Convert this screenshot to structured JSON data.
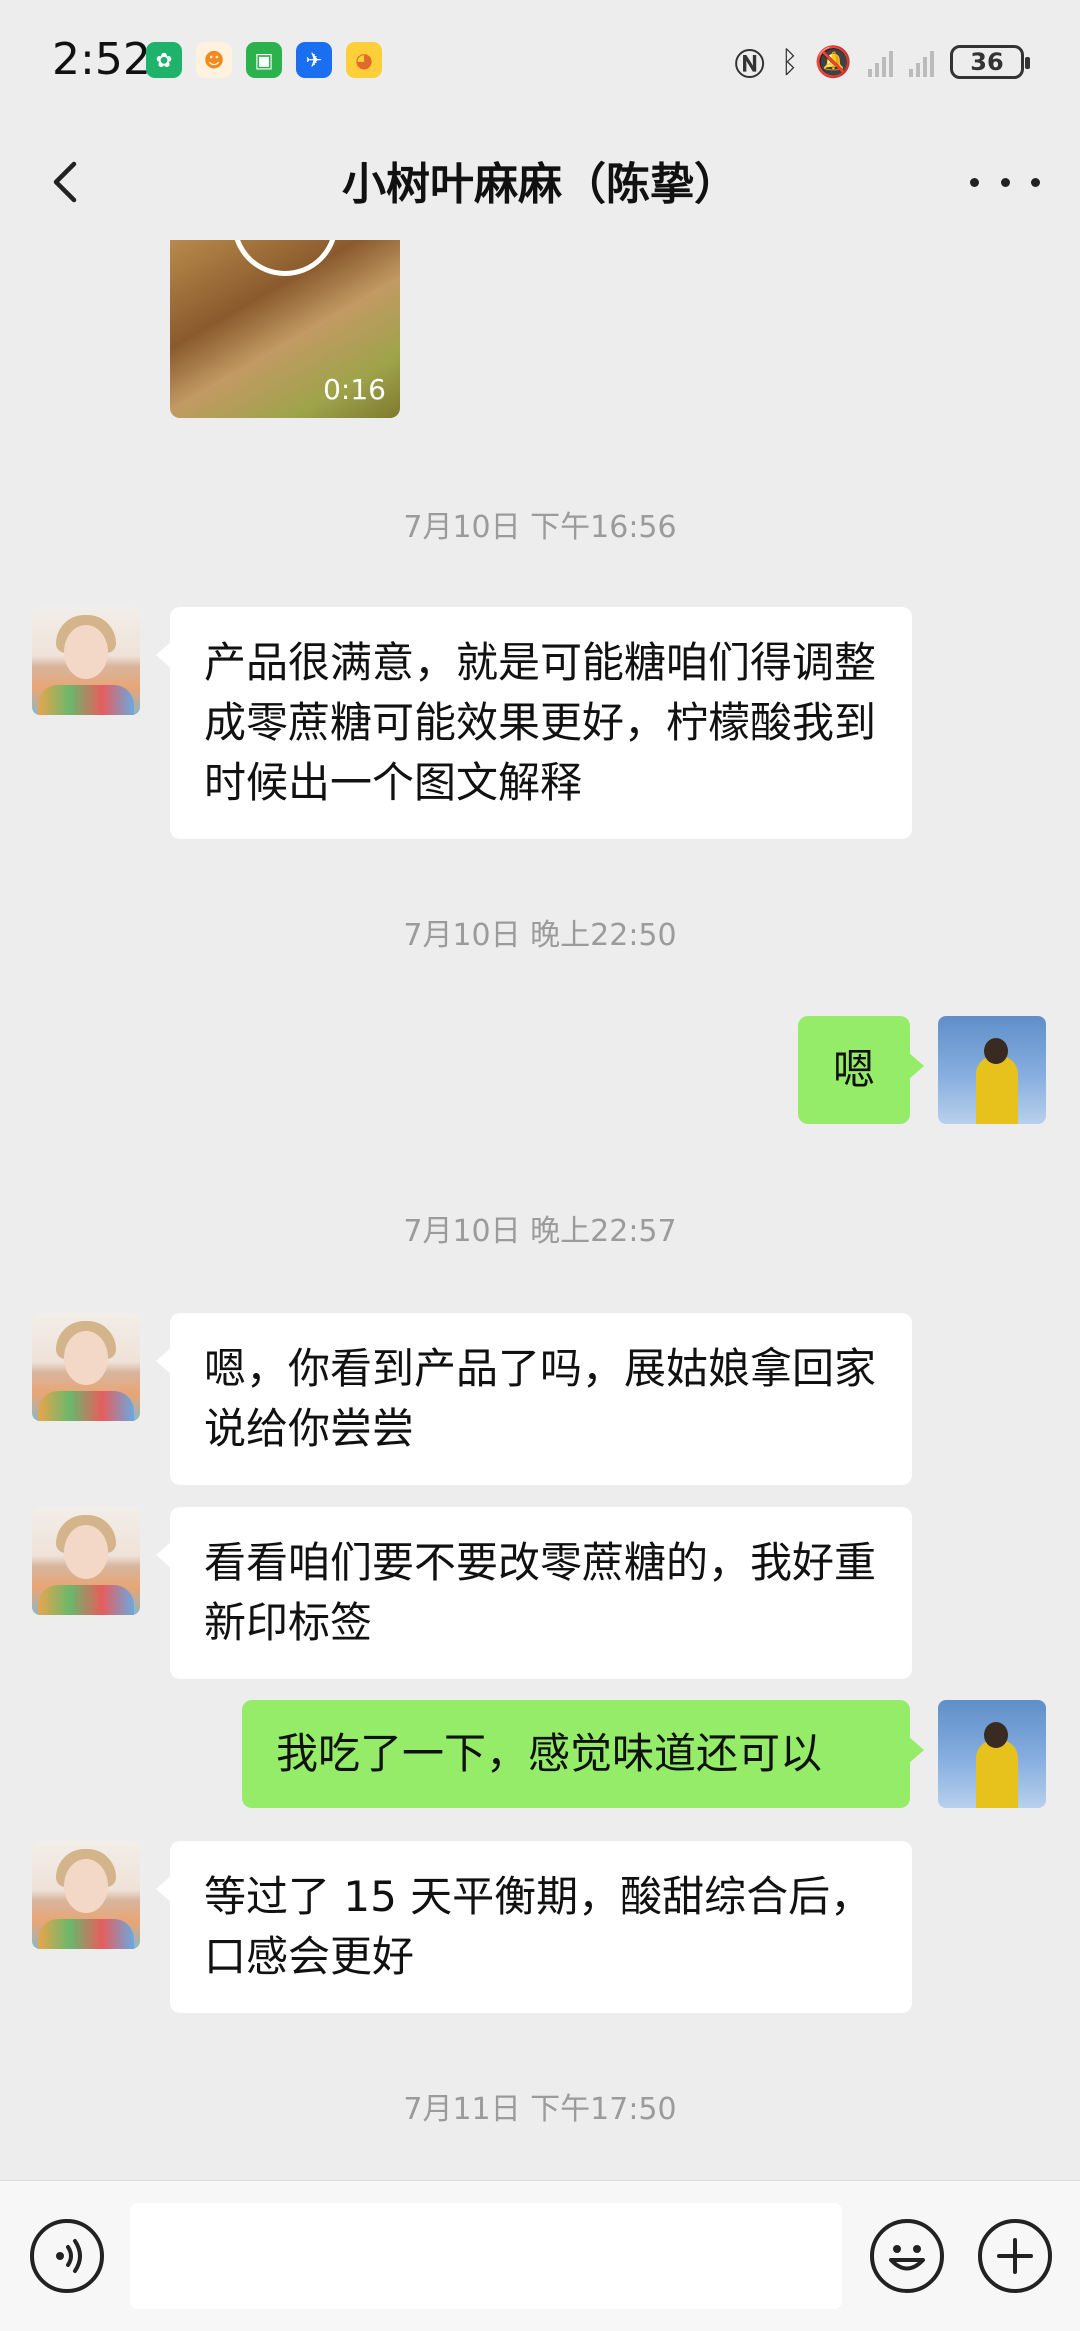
{
  "status_bar": {
    "time": "2:52",
    "battery": "36",
    "notification_icons": [
      "app-green-leaf-icon",
      "app-orange-figure-icon",
      "app-green-bag-icon",
      "app-blue-plane-icon",
      "app-yellow-duck-icon"
    ]
  },
  "header": {
    "title": "小树叶麻麻（陈挚）"
  },
  "video": {
    "duration": "0:16"
  },
  "messages": [
    {
      "type": "timestamp",
      "text": "7月10日 下午16:56"
    },
    {
      "type": "incoming",
      "text": "产品很满意，就是可能糖咱们得调整成零蔗糖可能效果更好，柠檬酸我到时候出一个图文解释"
    },
    {
      "type": "timestamp",
      "text": "7月10日 晚上22:50"
    },
    {
      "type": "outgoing",
      "text": "嗯"
    },
    {
      "type": "timestamp",
      "text": "7月10日 晚上22:57"
    },
    {
      "type": "incoming",
      "text": "嗯，你看到产品了吗，展姑娘拿回家说给你尝尝"
    },
    {
      "type": "incoming",
      "text": "看看咱们要不要改零蔗糖的，我好重新印标签"
    },
    {
      "type": "outgoing",
      "text": "我吃了一下，感觉味道还可以"
    },
    {
      "type": "incoming",
      "text": "等过了 15 天平衡期，酸甜综合后，口感会更好"
    },
    {
      "type": "timestamp",
      "text": "7月11日 下午17:50"
    }
  ],
  "colors": {
    "background": "#ededed",
    "outgoing_bubble": "#95ec69",
    "incoming_bubble": "#ffffff",
    "timestamp_text": "#9b9b9b"
  }
}
